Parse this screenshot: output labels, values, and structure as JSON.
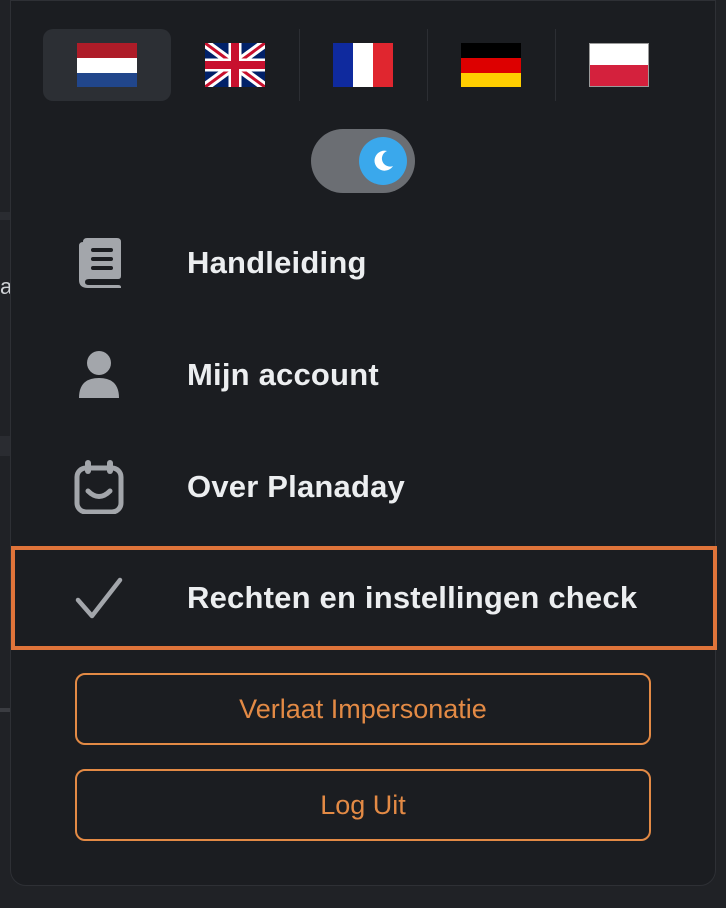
{
  "colors": {
    "background": "#1b1d21",
    "accent": "#e38a45",
    "highlight_border": "#e0743a",
    "toggle_knob": "#3aa8ec",
    "icon": "#a3a6ab",
    "label": "#eceef0"
  },
  "languages": [
    {
      "code": "nl",
      "name": "Nederlands",
      "icon": "flag-netherlands",
      "active": true
    },
    {
      "code": "en",
      "name": "English",
      "icon": "flag-united-kingdom",
      "active": false
    },
    {
      "code": "fr",
      "name": "Français",
      "icon": "flag-france",
      "active": false
    },
    {
      "code": "de",
      "name": "Deutsch",
      "icon": "flag-germany",
      "active": false
    },
    {
      "code": "pl",
      "name": "Polski",
      "icon": "flag-poland",
      "active": false
    }
  ],
  "theme_toggle": {
    "mode": "dark",
    "icon": "moon-icon"
  },
  "menu": {
    "items": [
      {
        "label": "Handleiding",
        "icon": "book-icon"
      },
      {
        "label": "Mijn account",
        "icon": "user-icon"
      },
      {
        "label": "Over Planaday",
        "icon": "calendar-smile-icon"
      },
      {
        "label": "Rechten en instellingen check",
        "icon": "check-icon",
        "highlighted": true
      }
    ]
  },
  "buttons": {
    "leave_impersonation": "Verlaat Impersonatie",
    "logout": "Log Uit"
  },
  "background_peek": {
    "text": "a"
  }
}
